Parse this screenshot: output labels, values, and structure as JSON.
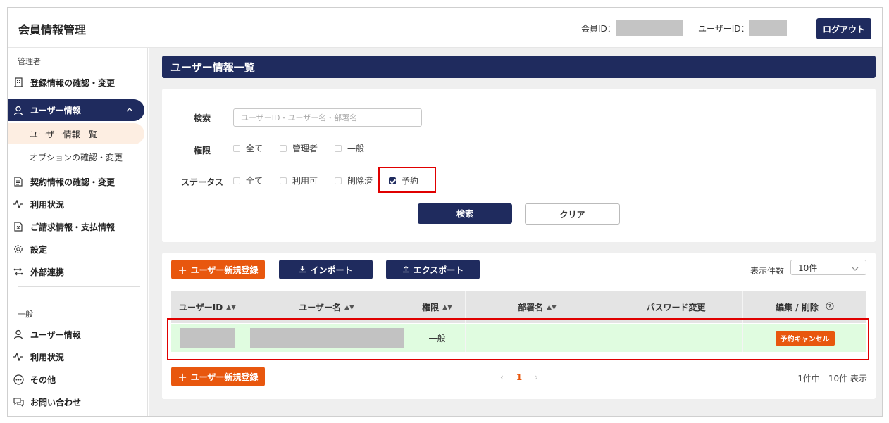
{
  "header": {
    "app_title": "会員情報管理",
    "member_id_label": "会員ID：",
    "user_id_label": "ユーザーID：",
    "logout_label": "ログアウト"
  },
  "sidebar": {
    "admin_section": "管理者",
    "general_section": "一般",
    "admin_items": [
      {
        "label": "登録情報の確認・変更",
        "icon": "building-icon"
      },
      {
        "label": "ユーザー情報",
        "icon": "user-icon"
      },
      {
        "label": "契約情報の確認・変更",
        "icon": "document-icon"
      },
      {
        "label": "利用状況",
        "icon": "pulse-icon"
      },
      {
        "label": "ご請求情報・支払情報",
        "icon": "invoice-icon"
      },
      {
        "label": "設定",
        "icon": "gear-icon"
      },
      {
        "label": "外部連携",
        "icon": "link-icon"
      }
    ],
    "sub_items": [
      {
        "label": "ユーザー情報一覧"
      },
      {
        "label": "オプションの確認・変更"
      }
    ],
    "general_items": [
      {
        "label": "ユーザー情報",
        "icon": "user-icon"
      },
      {
        "label": "利用状況",
        "icon": "pulse-icon"
      },
      {
        "label": "その他",
        "icon": "more-icon"
      },
      {
        "label": "お問い合わせ",
        "icon": "chat-icon"
      }
    ]
  },
  "main": {
    "page_title": "ユーザー情報一覧",
    "search": {
      "search_label": "検索",
      "placeholder": "ユーザーID・ユーザー名・部署名",
      "role_label": "権限",
      "role_options": [
        {
          "label": "全て",
          "checked": false
        },
        {
          "label": "管理者",
          "checked": false
        },
        {
          "label": "一般",
          "checked": false
        }
      ],
      "status_label": "ステータス",
      "status_options": [
        {
          "label": "全て",
          "checked": false
        },
        {
          "label": "利用可",
          "checked": false
        },
        {
          "label": "削除済",
          "checked": false
        },
        {
          "label": "予約",
          "checked": true
        }
      ],
      "search_button": "検索",
      "clear_button": "クリア"
    },
    "list": {
      "new_user_button": "ユーザー新規登録",
      "import_button": "インポート",
      "export_button": "エクスポート",
      "per_page_label": "表示件数",
      "per_page_value": "10件",
      "columns": [
        "ユーザーID",
        "ユーザー名",
        "権限",
        "部署名",
        "パスワード変更",
        "編集 / 削除"
      ],
      "rows": [
        {
          "role": "一般",
          "department": "",
          "action": "予約キャンセル"
        }
      ],
      "current_page": "1",
      "count_text": "1件中 - 10件 表示"
    }
  },
  "colors": {
    "navy": "#1f2b5e",
    "orange": "#e8570e",
    "row_bg": "#e0fce0",
    "highlight": "#e00000"
  }
}
